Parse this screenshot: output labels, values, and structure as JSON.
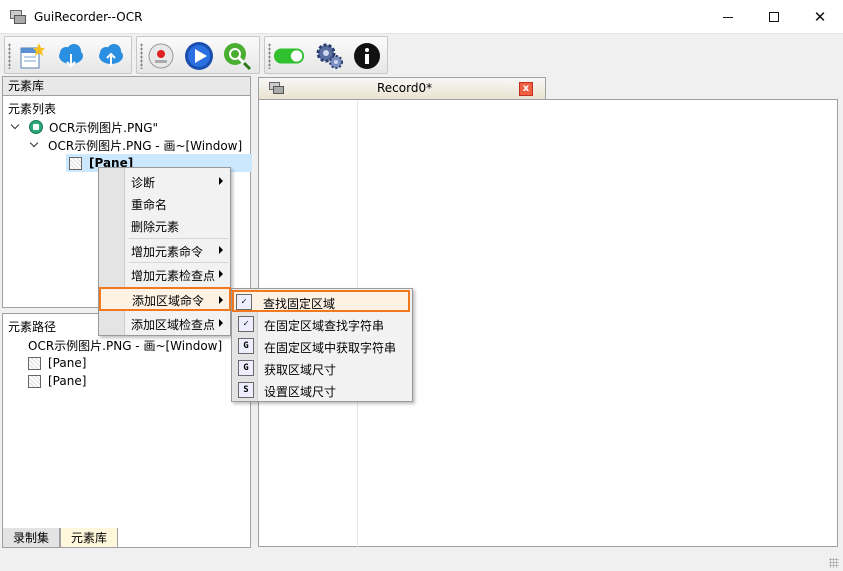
{
  "window": {
    "title": "GuiRecorder--OCR",
    "minimize": "—",
    "close": "✕"
  },
  "toolbar": {
    "buttons": [
      "new-record-icon",
      "download-cloud-icon",
      "upload-cloud-icon",
      "record-icon",
      "play-icon",
      "inspect-icon",
      "toggle-icon",
      "settings-icon",
      "info-icon"
    ]
  },
  "left": {
    "header": "元素库",
    "element_list_label": "元素列表",
    "tree": {
      "root": "OCR示例图片.PNG\"",
      "child": "OCR示例图片.PNG - 画~[Window]",
      "leaf": "[Pane]"
    },
    "path_label": "元素路径",
    "path": {
      "item0": "OCR示例图片.PNG - 画~[Window]",
      "item1": "[Pane]",
      "item2": "[Pane]"
    },
    "tabs": [
      "录制集",
      "元素库"
    ]
  },
  "doc": {
    "tab_title": "Record0*",
    "tab_close": "x"
  },
  "context_menu": {
    "items": [
      "诊断",
      "重命名",
      "删除元素",
      "增加元素命令",
      "增加元素检查点",
      "添加区域命令",
      "添加区域检查点"
    ]
  },
  "submenu": {
    "items": [
      {
        "label": "查找固定区域",
        "icon": "find-region-icon"
      },
      {
        "label": "在固定区域查找字符串",
        "icon": "find-string-icon"
      },
      {
        "label": "在固定区域中获取字符串",
        "icon": "get-string-icon"
      },
      {
        "label": "获取区域尺寸",
        "icon": "get-size-icon"
      },
      {
        "label": "设置区域尺寸",
        "icon": "set-size-icon"
      }
    ]
  },
  "colors": {
    "highlight_border": "#f07820",
    "selection": "#cce8ff",
    "tab_close": "#f06040"
  }
}
